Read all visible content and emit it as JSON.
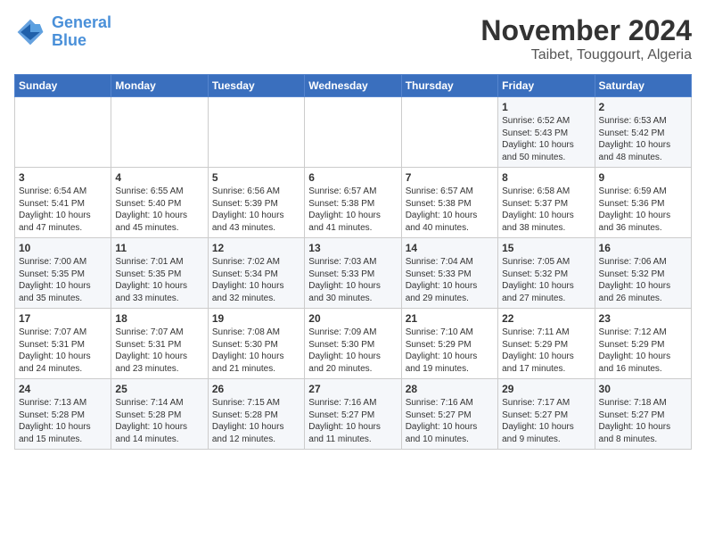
{
  "header": {
    "logo_line1": "General",
    "logo_line2": "Blue",
    "month": "November 2024",
    "location": "Taibet, Touggourt, Algeria"
  },
  "weekdays": [
    "Sunday",
    "Monday",
    "Tuesday",
    "Wednesday",
    "Thursday",
    "Friday",
    "Saturday"
  ],
  "weeks": [
    [
      {
        "day": "",
        "info": ""
      },
      {
        "day": "",
        "info": ""
      },
      {
        "day": "",
        "info": ""
      },
      {
        "day": "",
        "info": ""
      },
      {
        "day": "",
        "info": ""
      },
      {
        "day": "1",
        "info": "Sunrise: 6:52 AM\nSunset: 5:43 PM\nDaylight: 10 hours\nand 50 minutes."
      },
      {
        "day": "2",
        "info": "Sunrise: 6:53 AM\nSunset: 5:42 PM\nDaylight: 10 hours\nand 48 minutes."
      }
    ],
    [
      {
        "day": "3",
        "info": "Sunrise: 6:54 AM\nSunset: 5:41 PM\nDaylight: 10 hours\nand 47 minutes."
      },
      {
        "day": "4",
        "info": "Sunrise: 6:55 AM\nSunset: 5:40 PM\nDaylight: 10 hours\nand 45 minutes."
      },
      {
        "day": "5",
        "info": "Sunrise: 6:56 AM\nSunset: 5:39 PM\nDaylight: 10 hours\nand 43 minutes."
      },
      {
        "day": "6",
        "info": "Sunrise: 6:57 AM\nSunset: 5:38 PM\nDaylight: 10 hours\nand 41 minutes."
      },
      {
        "day": "7",
        "info": "Sunrise: 6:57 AM\nSunset: 5:38 PM\nDaylight: 10 hours\nand 40 minutes."
      },
      {
        "day": "8",
        "info": "Sunrise: 6:58 AM\nSunset: 5:37 PM\nDaylight: 10 hours\nand 38 minutes."
      },
      {
        "day": "9",
        "info": "Sunrise: 6:59 AM\nSunset: 5:36 PM\nDaylight: 10 hours\nand 36 minutes."
      }
    ],
    [
      {
        "day": "10",
        "info": "Sunrise: 7:00 AM\nSunset: 5:35 PM\nDaylight: 10 hours\nand 35 minutes."
      },
      {
        "day": "11",
        "info": "Sunrise: 7:01 AM\nSunset: 5:35 PM\nDaylight: 10 hours\nand 33 minutes."
      },
      {
        "day": "12",
        "info": "Sunrise: 7:02 AM\nSunset: 5:34 PM\nDaylight: 10 hours\nand 32 minutes."
      },
      {
        "day": "13",
        "info": "Sunrise: 7:03 AM\nSunset: 5:33 PM\nDaylight: 10 hours\nand 30 minutes."
      },
      {
        "day": "14",
        "info": "Sunrise: 7:04 AM\nSunset: 5:33 PM\nDaylight: 10 hours\nand 29 minutes."
      },
      {
        "day": "15",
        "info": "Sunrise: 7:05 AM\nSunset: 5:32 PM\nDaylight: 10 hours\nand 27 minutes."
      },
      {
        "day": "16",
        "info": "Sunrise: 7:06 AM\nSunset: 5:32 PM\nDaylight: 10 hours\nand 26 minutes."
      }
    ],
    [
      {
        "day": "17",
        "info": "Sunrise: 7:07 AM\nSunset: 5:31 PM\nDaylight: 10 hours\nand 24 minutes."
      },
      {
        "day": "18",
        "info": "Sunrise: 7:07 AM\nSunset: 5:31 PM\nDaylight: 10 hours\nand 23 minutes."
      },
      {
        "day": "19",
        "info": "Sunrise: 7:08 AM\nSunset: 5:30 PM\nDaylight: 10 hours\nand 21 minutes."
      },
      {
        "day": "20",
        "info": "Sunrise: 7:09 AM\nSunset: 5:30 PM\nDaylight: 10 hours\nand 20 minutes."
      },
      {
        "day": "21",
        "info": "Sunrise: 7:10 AM\nSunset: 5:29 PM\nDaylight: 10 hours\nand 19 minutes."
      },
      {
        "day": "22",
        "info": "Sunrise: 7:11 AM\nSunset: 5:29 PM\nDaylight: 10 hours\nand 17 minutes."
      },
      {
        "day": "23",
        "info": "Sunrise: 7:12 AM\nSunset: 5:29 PM\nDaylight: 10 hours\nand 16 minutes."
      }
    ],
    [
      {
        "day": "24",
        "info": "Sunrise: 7:13 AM\nSunset: 5:28 PM\nDaylight: 10 hours\nand 15 minutes."
      },
      {
        "day": "25",
        "info": "Sunrise: 7:14 AM\nSunset: 5:28 PM\nDaylight: 10 hours\nand 14 minutes."
      },
      {
        "day": "26",
        "info": "Sunrise: 7:15 AM\nSunset: 5:28 PM\nDaylight: 10 hours\nand 12 minutes."
      },
      {
        "day": "27",
        "info": "Sunrise: 7:16 AM\nSunset: 5:27 PM\nDaylight: 10 hours\nand 11 minutes."
      },
      {
        "day": "28",
        "info": "Sunrise: 7:16 AM\nSunset: 5:27 PM\nDaylight: 10 hours\nand 10 minutes."
      },
      {
        "day": "29",
        "info": "Sunrise: 7:17 AM\nSunset: 5:27 PM\nDaylight: 10 hours\nand 9 minutes."
      },
      {
        "day": "30",
        "info": "Sunrise: 7:18 AM\nSunset: 5:27 PM\nDaylight: 10 hours\nand 8 minutes."
      }
    ]
  ]
}
